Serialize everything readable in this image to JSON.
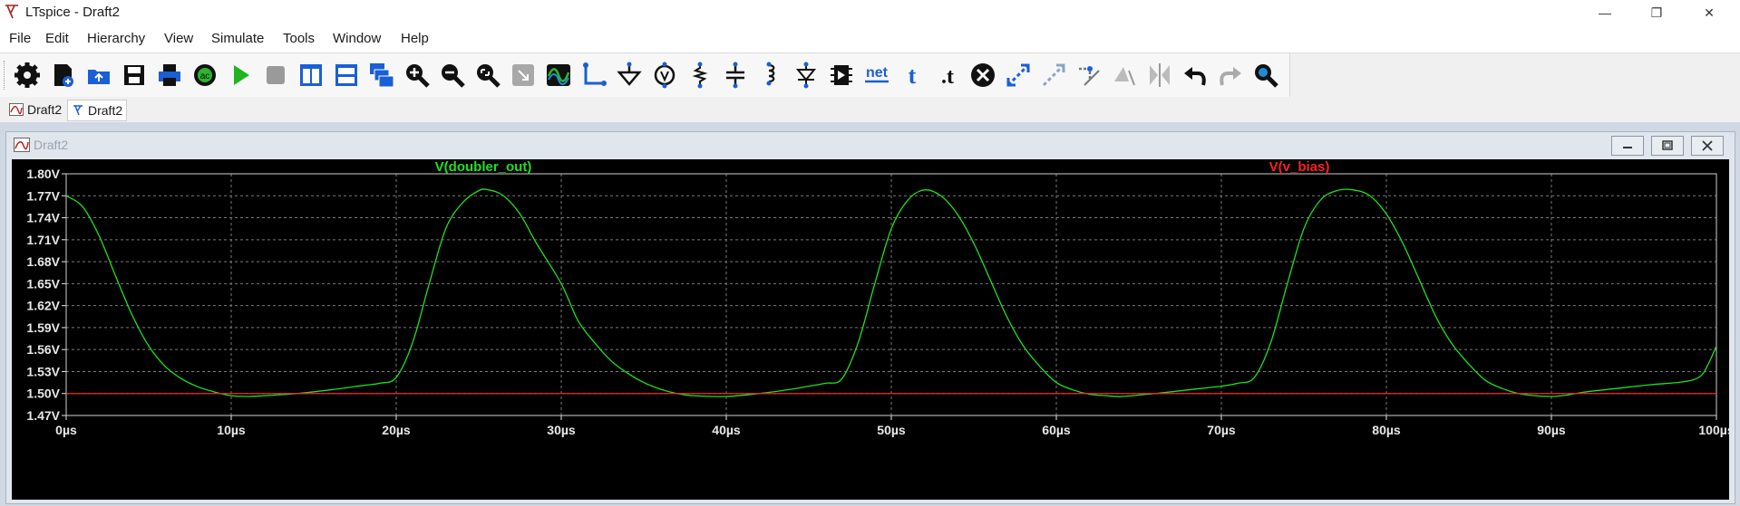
{
  "window": {
    "title": "LTspice - Draft2",
    "controls": {
      "minimize": "—",
      "restore": "❐",
      "close": "✕"
    }
  },
  "menu": [
    "File",
    "Edit",
    "Hierarchy",
    "View",
    "Simulate",
    "Tools",
    "Window",
    "Help"
  ],
  "toolbar": {
    "buttons": [
      "settings-icon",
      "new-schematic-icon",
      "open-icon",
      "save-icon",
      "print-icon",
      "ac-analysis-icon",
      "run-icon",
      "halt-icon",
      "tile-vertical-icon",
      "tile-horizontal-icon",
      "cascade-icon",
      "zoom-in-icon",
      "zoom-out-icon",
      "zoom-fit-icon",
      "zoom-area-icon",
      "autoscale-icon",
      "wire-icon",
      "ground-icon",
      "voltage-source-icon",
      "resistor-icon",
      "capacitor-icon",
      "inductor-icon",
      "diode-icon",
      "component-icon",
      "net-label-icon",
      "text-icon",
      "spice-directive-icon",
      "delete-icon",
      "move-icon",
      "drag-icon",
      "rotate-icon",
      "mirror-icon",
      "flip-icon",
      "undo-icon",
      "redo-icon",
      "find-icon"
    ],
    "net_label": "net",
    "text_label": "t",
    "directive_label": ".t",
    "ac_label": "ac"
  },
  "tabs": [
    {
      "label": "Draft2",
      "icon": "waveform-tab-icon"
    },
    {
      "label": "Draft2",
      "icon": "schematic-tab-icon"
    }
  ],
  "plot_window": {
    "title": "Draft2"
  },
  "colors": {
    "plot_bg": "#000000",
    "grid": "#7a7a7a",
    "axis_text": "#e8e8e8",
    "trace_green": "#1fe01f",
    "trace_red": "#ff2020"
  },
  "chart_data": {
    "type": "line",
    "title": "",
    "xlabel": "",
    "ylabel": "",
    "x_unit": "µs",
    "y_unit": "V",
    "xlim": [
      0,
      100
    ],
    "ylim": [
      1.47,
      1.8
    ],
    "xticks": [
      0,
      10,
      20,
      30,
      40,
      50,
      60,
      70,
      80,
      90,
      100
    ],
    "xtick_labels": [
      "0µs",
      "10µs",
      "20µs",
      "30µs",
      "40µs",
      "50µs",
      "60µs",
      "70µs",
      "80µs",
      "90µs",
      "100µs"
    ],
    "yticks": [
      1.47,
      1.5,
      1.53,
      1.56,
      1.59,
      1.62,
      1.65,
      1.68,
      1.71,
      1.74,
      1.77,
      1.8
    ],
    "ytick_labels": [
      "1.47V",
      "1.50V",
      "1.53V",
      "1.56V",
      "1.59V",
      "1.62V",
      "1.65V",
      "1.68V",
      "1.71V",
      "1.74V",
      "1.77V",
      "1.80V"
    ],
    "grid": true,
    "series": [
      {
        "name": "V(doubler_out)",
        "color": "#1fe01f",
        "x": [
          0,
          1,
          2,
          3,
          4,
          5,
          6,
          7,
          8,
          9,
          10,
          11,
          12,
          14,
          16,
          18,
          19,
          20,
          21,
          22,
          23,
          24,
          25,
          25.6,
          26.5,
          27.5,
          28.5,
          30,
          31,
          32,
          33,
          34,
          35,
          36,
          37,
          38,
          40,
          42,
          44,
          45,
          46,
          47,
          48,
          49,
          50,
          51,
          52,
          53,
          54,
          55,
          56,
          57,
          58,
          59,
          60,
          61,
          62,
          63,
          64,
          66,
          68,
          70,
          71,
          72,
          73,
          74,
          75,
          76,
          77,
          78,
          79,
          80,
          81,
          82,
          83,
          84,
          85,
          86,
          87,
          88,
          89,
          90,
          91,
          92,
          94,
          96,
          98,
          99,
          99.5,
          100
        ],
        "y": [
          1.77,
          1.755,
          1.715,
          1.66,
          1.607,
          1.565,
          1.537,
          1.52,
          1.509,
          1.502,
          1.497,
          1.496,
          1.497,
          1.5,
          1.505,
          1.511,
          1.514,
          1.522,
          1.57,
          1.65,
          1.725,
          1.76,
          1.777,
          1.778,
          1.77,
          1.745,
          1.705,
          1.65,
          1.6,
          1.57,
          1.545,
          1.528,
          1.515,
          1.506,
          1.5,
          1.497,
          1.496,
          1.5,
          1.506,
          1.51,
          1.514,
          1.52,
          1.57,
          1.65,
          1.725,
          1.764,
          1.778,
          1.77,
          1.745,
          1.705,
          1.655,
          1.605,
          1.565,
          1.537,
          1.515,
          1.505,
          1.499,
          1.497,
          1.496,
          1.5,
          1.505,
          1.51,
          1.514,
          1.522,
          1.57,
          1.65,
          1.725,
          1.764,
          1.777,
          1.778,
          1.77,
          1.745,
          1.705,
          1.655,
          1.605,
          1.567,
          1.54,
          1.518,
          1.507,
          1.5,
          1.497,
          1.496,
          1.498,
          1.502,
          1.507,
          1.512,
          1.516,
          1.523,
          1.54,
          1.565
        ]
      },
      {
        "name": "V(v_bias)",
        "color": "#ff2020",
        "x": [
          0,
          100
        ],
        "y": [
          1.5,
          1.5
        ]
      }
    ]
  }
}
